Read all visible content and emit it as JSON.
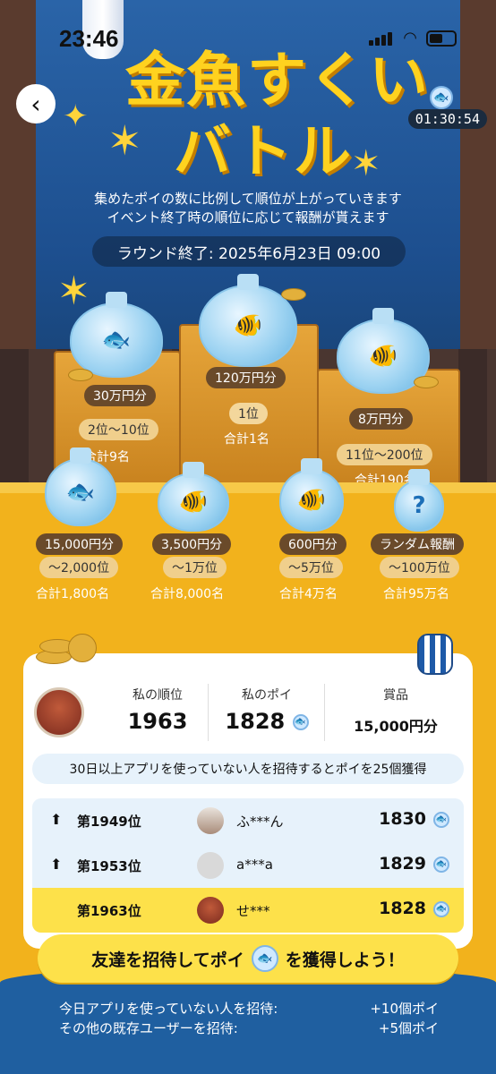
{
  "status_bar": {
    "time": "23:46"
  },
  "header": {
    "title_line1": "金魚すくい",
    "title_line2": "バトル",
    "timer": "01:30:54"
  },
  "description": {
    "line1": "集めたポイの数に比例して順位が上がっていきます",
    "line2": "イベント終了時の順位に応じて報酬が貰えます"
  },
  "round_end": "ラウンド終了: 2025年6月23日 09:00",
  "podium": {
    "first": {
      "prize": "120万円分",
      "rank": "1位",
      "total": "合計1名"
    },
    "second": {
      "prize": "30万円分",
      "rank": "2位〜10位",
      "total": "合計9名"
    },
    "third": {
      "prize": "8万円分",
      "rank": "11位〜200位",
      "total": "合計190名"
    }
  },
  "lower_prizes": [
    {
      "prize": "15,000円分",
      "rank": "〜2,000位",
      "total": "合計1,800名"
    },
    {
      "prize": "3,500円分",
      "rank": "〜1万位",
      "total": "合計8,000名"
    },
    {
      "prize": "600円分",
      "rank": "〜5万位",
      "total": "合計4万名"
    },
    {
      "prize": "ランダム報酬",
      "rank": "〜100万位",
      "total": "合計95万名"
    }
  ],
  "my_stats": {
    "rank_label": "私の順位",
    "rank_value": "1963",
    "poi_label": "私のポイ",
    "poi_value": "1828",
    "prize_label": "賞品",
    "prize_value": "15,000円分"
  },
  "invite_banner": "30日以上アプリを使っていない人を招待するとポイを25個獲得",
  "ranking": [
    {
      "rank": "第1949位",
      "name": "ふ***ん",
      "points": "1830",
      "trend": "up"
    },
    {
      "rank": "第1953位",
      "name": "a***a",
      "points": "1829",
      "trend": "up"
    },
    {
      "rank": "第1963位",
      "name": "せ***",
      "points": "1828",
      "trend": "self"
    }
  ],
  "cta": {
    "before": "友達を招待してポイ",
    "after": "を獲得しよう！"
  },
  "bonuses": [
    {
      "label": "今日アプリを使っていない人を招待:",
      "value": "+10個ポイ"
    },
    {
      "label": "その他の既存ユーザーを招待:",
      "value": "+5個ポイ"
    }
  ],
  "colors": {
    "accent_yellow": "#fde14a",
    "banner_blue": "#1d4f8f",
    "title_yellow": "#ffd21f"
  },
  "icons": [
    "back-icon",
    "signal-icon",
    "wifi-icon",
    "battery-icon",
    "poi-icon",
    "up-arrow-icon",
    "lantern-icon"
  ]
}
